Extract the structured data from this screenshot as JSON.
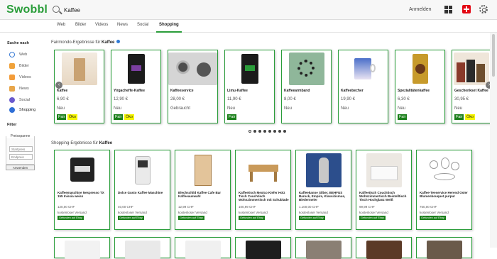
{
  "header": {
    "logo": "Swobbl",
    "search_value": "Kaffee",
    "login": "Anmelden",
    "icons": [
      "search-icon",
      "grid-icon",
      "swiss-flag-icon",
      "gear-icon"
    ],
    "accent": "#2a9d3a"
  },
  "tabs": [
    {
      "label": "Web"
    },
    {
      "label": "Bilder"
    },
    {
      "label": "Videos"
    },
    {
      "label": "News"
    },
    {
      "label": "Social"
    },
    {
      "label": "Shopping",
      "active": true
    }
  ],
  "sidebar": {
    "title": "Suche nach",
    "items": [
      "Web",
      "Bilder",
      "Videos",
      "News",
      "Social",
      "Shopping"
    ],
    "filter_title": "Filter",
    "price_title": "Preisspanne",
    "start_placeholder": "Startpreis",
    "end_placeholder": "Endpreis",
    "apply_label": "Anwenden"
  },
  "fairmondo": {
    "title_prefix": "Fairmondo-Ergebnisse für",
    "query": "Kaffee",
    "cards": [
      {
        "title": "Kaffee",
        "price": "6,90 €",
        "condition": "Neu",
        "badges": [
          "Fair",
          "Öko"
        ]
      },
      {
        "title": "Yirgacheffe-Kaffee",
        "price": "12,90 €",
        "condition": "Neu",
        "badges": [
          "Fair",
          "Öko"
        ]
      },
      {
        "title": "Kaffeeservice",
        "price": "28,00 €",
        "condition": "Gebraucht",
        "badges": []
      },
      {
        "title": "Limu-Kaffee",
        "price": "11,90 €",
        "condition": "Neu",
        "badges": [
          "Fair"
        ]
      },
      {
        "title": "Kaffeearmband",
        "price": "8,00 €",
        "condition": "Neu",
        "badges": []
      },
      {
        "title": "Kaffeebecher",
        "price": "19,90 €",
        "condition": "Neu",
        "badges": []
      },
      {
        "title": "Spezialitätenkaffee",
        "price": "6,30 €",
        "condition": "Neu",
        "badges": [
          "Fair"
        ]
      },
      {
        "title": "Geschenkset Kaffee",
        "price": "30,95 €",
        "condition": "Neu",
        "badges": [
          "Fair",
          "Öko"
        ]
      }
    ],
    "pager_dots": 8,
    "active_dot": 0
  },
  "shopping": {
    "title_prefix": "Shopping-Ergebnisse für",
    "query": "Kaffee",
    "cards": [
      {
        "title": "Kaffeemaschine Nespresso TX 155 Inissia weiss",
        "price": "120,00 CHF",
        "shipping": "kostenloser Versand",
        "source": "Gefunden auf Ebay"
      },
      {
        "title": "Dolce Gusto Kaffee Maschine",
        "price": "40,00 CHF",
        "shipping": "kostenloser Versand",
        "source": "Gefunden auf Ebay"
      },
      {
        "title": "Blechschild Kaffee Cafe Bar Kaffeeauswahl",
        "price": "12,99 CHF",
        "shipping": "kostenloser Versand",
        "source": "Gefunden auf Ebay"
      },
      {
        "title": "Kaffeetisch Mexico Kiefer Holz Tisch Couchtisch Wohnzimmertisch mit Schublade",
        "price": "100,99 CHF",
        "shipping": "kostenloser Versand",
        "source": "Gefunden auf Ebay"
      },
      {
        "title": "Kaffeekanne Silber, BEHFUS Barock, Empire, Klassizismus, Biedermeier",
        "price": "1.100,00 CHF",
        "shipping": "kostenloser Versand",
        "source": "Gefunden auf Ebay"
      },
      {
        "title": "Kaffeetisch Couchtisch Wohnzimmertisch Beistelltisch Tisch Hochglanz Weiß",
        "price": "99,99 CHF",
        "shipping": "kostenloser Versand",
        "source": "Gefunden auf Ebay"
      },
      {
        "title": "Kaffee-Teeservice Herend Osier Blumenbouquet purpur",
        "price": "750,00 CHF",
        "shipping": "kostenloser Versand",
        "source": "Gefunden auf Ebay"
      }
    ]
  }
}
